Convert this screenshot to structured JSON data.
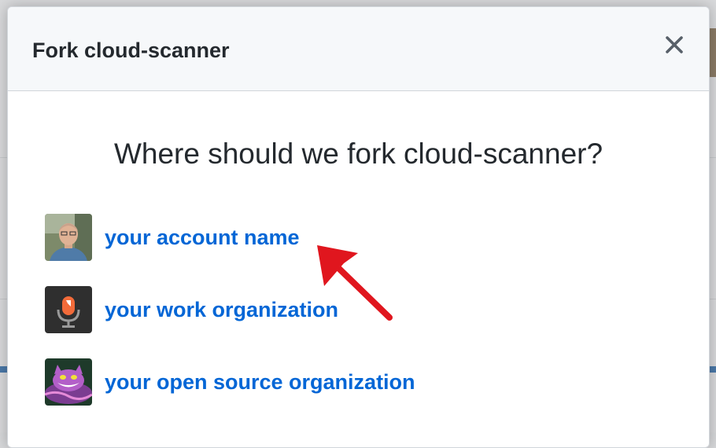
{
  "modal": {
    "title": "Fork cloud-scanner",
    "close_icon": "close-icon",
    "question": "Where should we fork cloud-scanner?"
  },
  "owners": [
    {
      "label": "your account name",
      "avatar": "user-photo-avatar"
    },
    {
      "label": "your work organization",
      "avatar": "microphone-logo-avatar"
    },
    {
      "label": "your open source organization",
      "avatar": "cheshire-cat-avatar"
    }
  ],
  "annotation": {
    "arrow_icon": "red-arrow-icon",
    "color": "#e0161e"
  },
  "colors": {
    "link": "#0366d6",
    "header_bg": "#f6f8fa",
    "text": "#24292e"
  }
}
